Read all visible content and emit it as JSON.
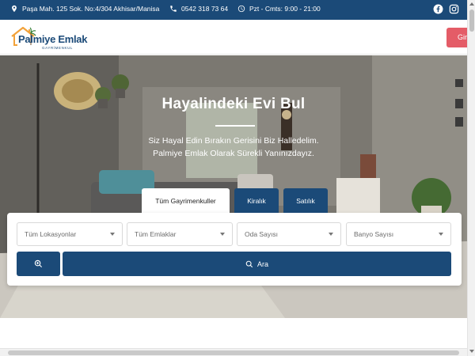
{
  "topbar": {
    "address": "Paşa Mah. 125 Sok. No:4/304 Akhisar/Manisa",
    "phone": "0542 318 73 64",
    "hours": "Pzt - Cmts: 9:00 - 21:00",
    "address_icon": "map-pin-icon",
    "phone_icon": "phone-icon",
    "hours_icon": "clock-icon",
    "social": [
      "facebook-icon",
      "instagram-icon"
    ]
  },
  "header": {
    "logo_title": "Palmiye Emlak",
    "logo_subtitle": "GAYRİMENKUL",
    "login_label": "Giriş"
  },
  "hero": {
    "title": "Hayalindeki Evi Bul",
    "subtitle_line1": "Siz Hayal Edin Bırakın Gerisini Biz Halledelim.",
    "subtitle_line2": "Palmiye Emlak Olarak Sürekli Yanınızdayız."
  },
  "tabs": [
    {
      "label": "Tüm Gayrimenkuller",
      "active": true
    },
    {
      "label": "Kiralık",
      "active": false
    },
    {
      "label": "Satılık",
      "active": false
    }
  ],
  "search": {
    "location_placeholder": "Tüm Lokasyonlar",
    "type_placeholder": "Tüm Emlaklar",
    "rooms_placeholder": "Oda Sayısı",
    "baths_placeholder": "Banyo Sayısı",
    "search_label": "Ara",
    "advanced_icon": "zoom-in-icon",
    "search_icon": "search-icon"
  },
  "colors": {
    "brand_blue": "#1b4a78",
    "login_red": "#e45c67",
    "logo_orange": "#f2a23a"
  }
}
